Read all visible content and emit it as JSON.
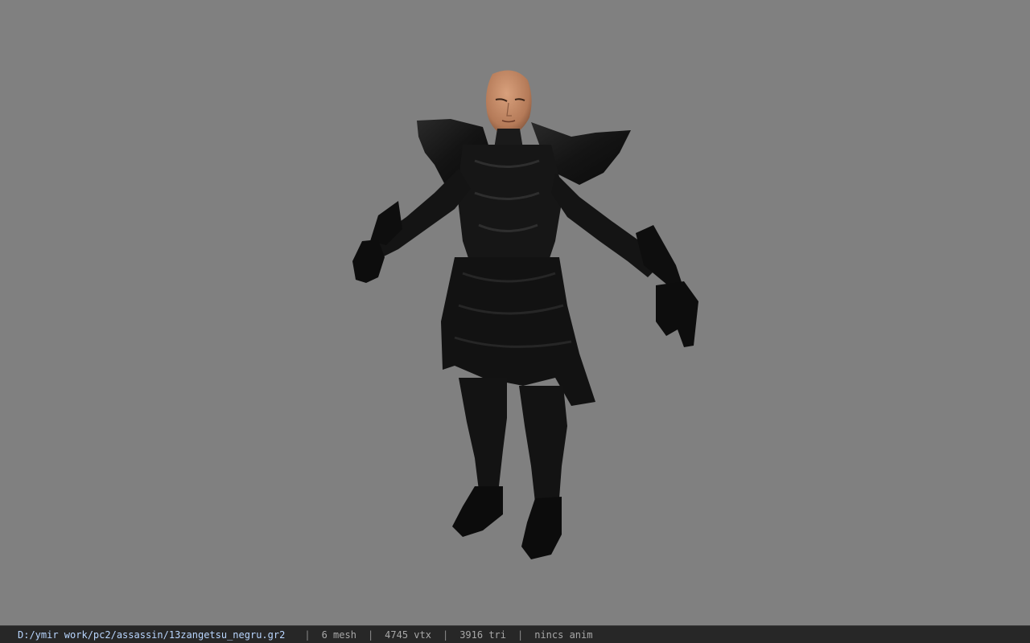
{
  "viewer": {
    "background_color": "#808080",
    "model_icon": "armored-character-model"
  },
  "statusbar": {
    "file_path": "D:/ymir work/pc2/assassin/13zangetsu_negru.gr2",
    "separator": "|",
    "mesh_count": "6 mesh",
    "vertex_count": "4745 vtx",
    "triangle_count": "3916 tri",
    "animation": "nincs anim"
  }
}
